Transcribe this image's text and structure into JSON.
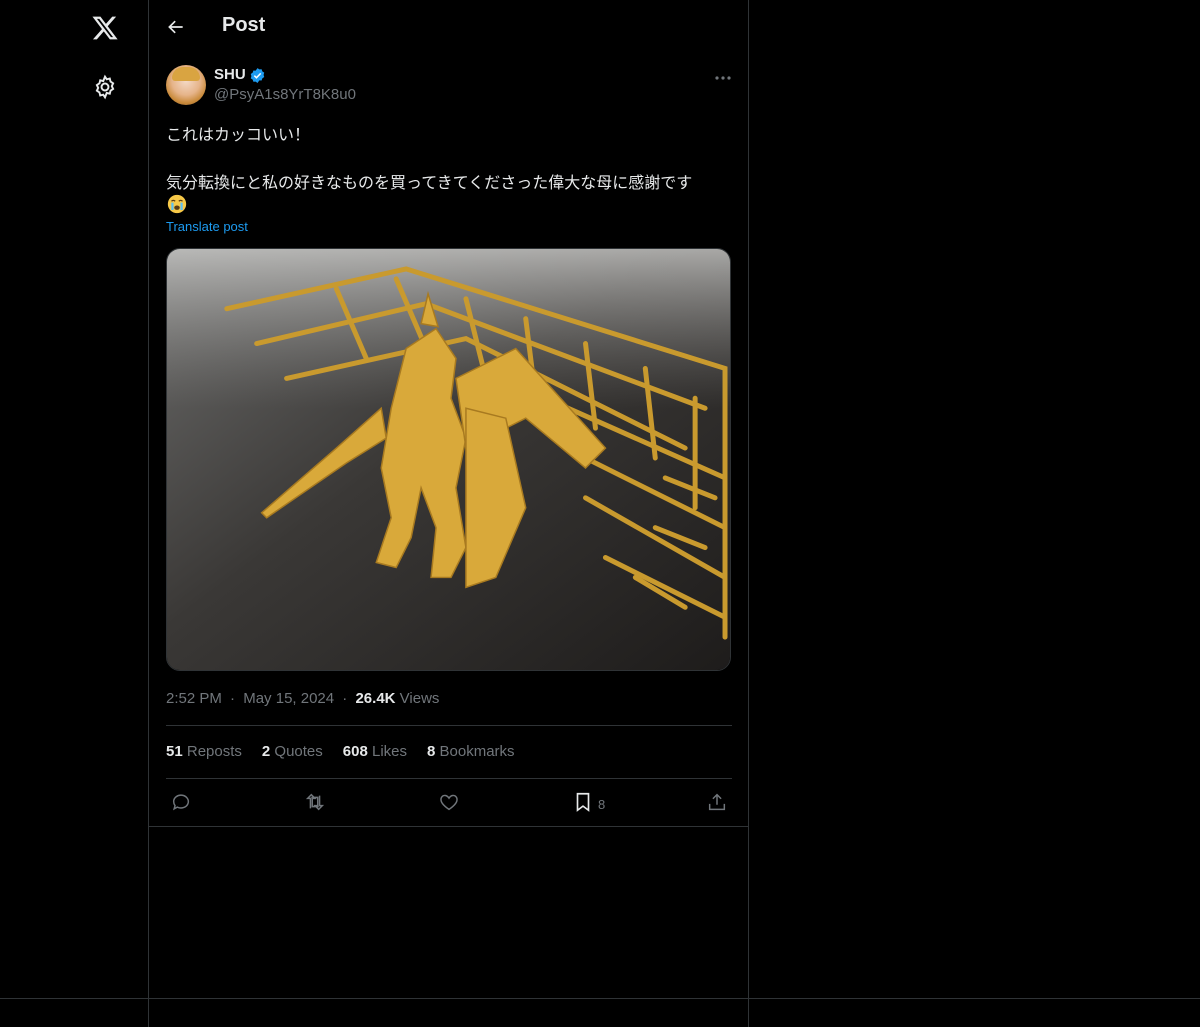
{
  "sidebar": {
    "logo_icon": "x-logo-icon",
    "settings_icon": "gear-icon"
  },
  "header": {
    "back_icon": "arrow-left-icon",
    "title": "Post"
  },
  "post": {
    "author_name": "SHU",
    "author_handle": "@PsyA1s8YrT8K8u0",
    "verified": true,
    "text_line_1": "これはカッコいい！",
    "text_line_2": "気分転換にと私の好きなものを買ってきてくださった偉大な母に感謝です",
    "emoji": "😭",
    "translate_label": "Translate post",
    "time": "2:52 PM",
    "separator": "·",
    "date": "May 15, 2024",
    "views_count": "26.4K",
    "views_label": "Views"
  },
  "stats": {
    "reposts_count": "51",
    "reposts_label": "Reposts",
    "quotes_count": "2",
    "quotes_label": "Quotes",
    "likes_count": "608",
    "likes_label": "Likes",
    "bookmarks_count": "8",
    "bookmarks_label": "Bookmarks"
  },
  "actions": {
    "reply_icon": "reply-icon",
    "repost_icon": "repost-icon",
    "like_icon": "heart-icon",
    "bookmark_icon": "bookmark-icon",
    "bookmark_count": "8",
    "share_icon": "share-icon"
  },
  "colors": {
    "background": "#000000",
    "text": "#e7e9ea",
    "muted": "#71767b",
    "accent": "#1d9bf0",
    "border": "#2f3336"
  }
}
